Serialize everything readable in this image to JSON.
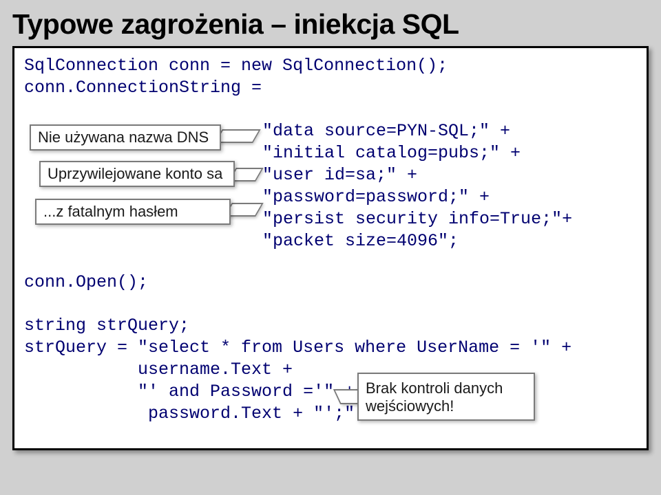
{
  "title": "Typowe zagrożenia – iniekcja SQL",
  "code": {
    "l1": "SqlConnection conn = new SqlConnection();",
    "l2": "conn.ConnectionString =",
    "cs1": "\"data source=PYN-SQL;\" +",
    "cs2": "\"initial catalog=pubs;\" +",
    "cs3": "\"user id=sa;\" +",
    "cs4": "\"password=password;\" +",
    "cs5": "\"persist security info=True;\"+",
    "cs6": "\"packet size=4096\";",
    "l3": "conn.Open();",
    "l4": "string strQuery;",
    "l5": "strQuery = \"select * from Users where UserName = '\" +",
    "l6": "           username.Text +",
    "l7": "           \"' and Password ='\" +",
    "l8": "            password.Text + \"';\";"
  },
  "callouts": {
    "c1": "Nie używana nazwa DNS",
    "c2": "Uprzywilejowane konto sa",
    "c3": "...z fatalnym hasłem",
    "c4": "Brak kontroli danych wejściowych!"
  }
}
